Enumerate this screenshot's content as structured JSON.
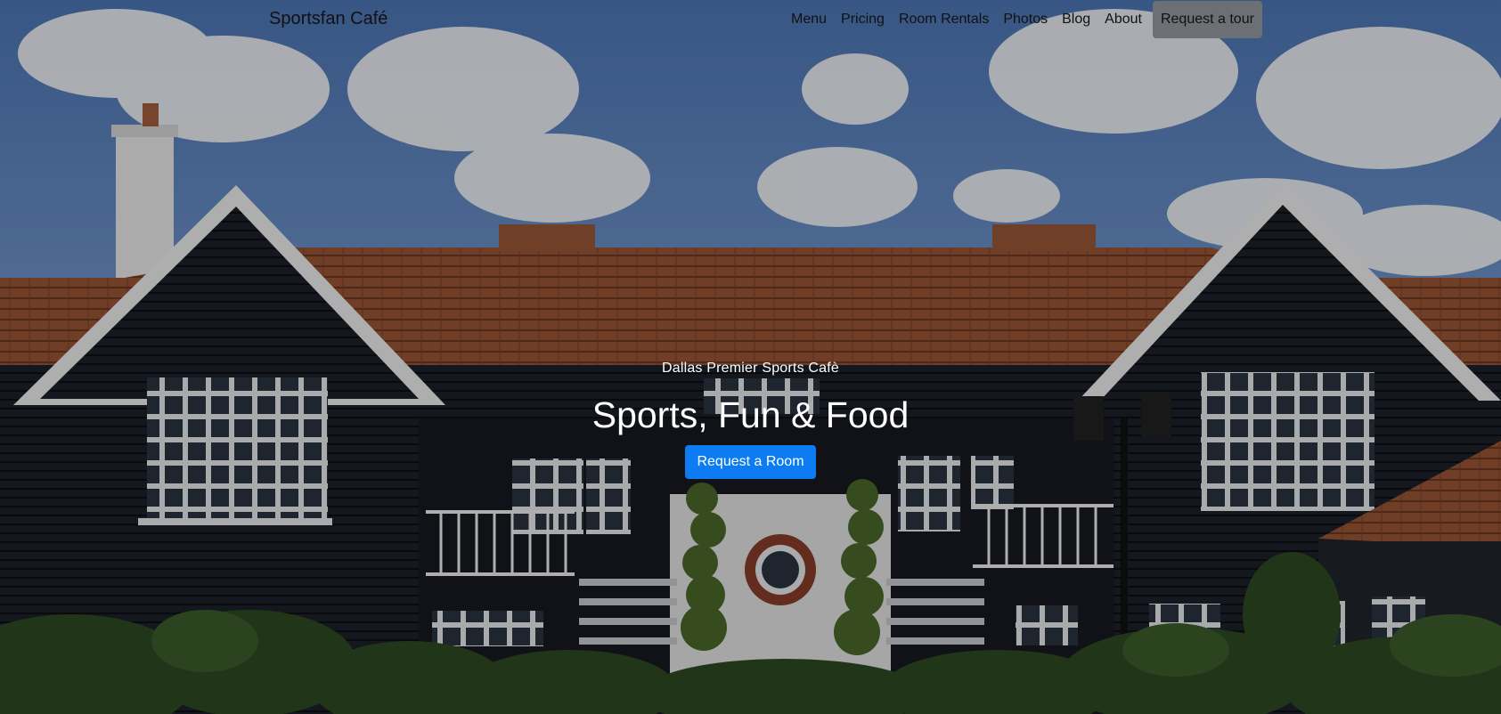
{
  "navbar": {
    "brand": "Sportsfan Café",
    "links": [
      "Menu",
      "Pricing",
      "Room Rentals",
      "Photos",
      "Blog",
      "About"
    ],
    "tour_button": "Request a tour"
  },
  "hero": {
    "subtitle": "Dallas Premier Sports Cafè",
    "title": "Sports, Fun & Food",
    "cta": "Request a Room",
    "background_icon": "house-photo",
    "colors": {
      "cta": "#0d7cf2",
      "tour_button": "#6c6f73",
      "sky": "#5d86c4",
      "roof": "#9a5a3a",
      "siding": "#1c1f26"
    }
  }
}
